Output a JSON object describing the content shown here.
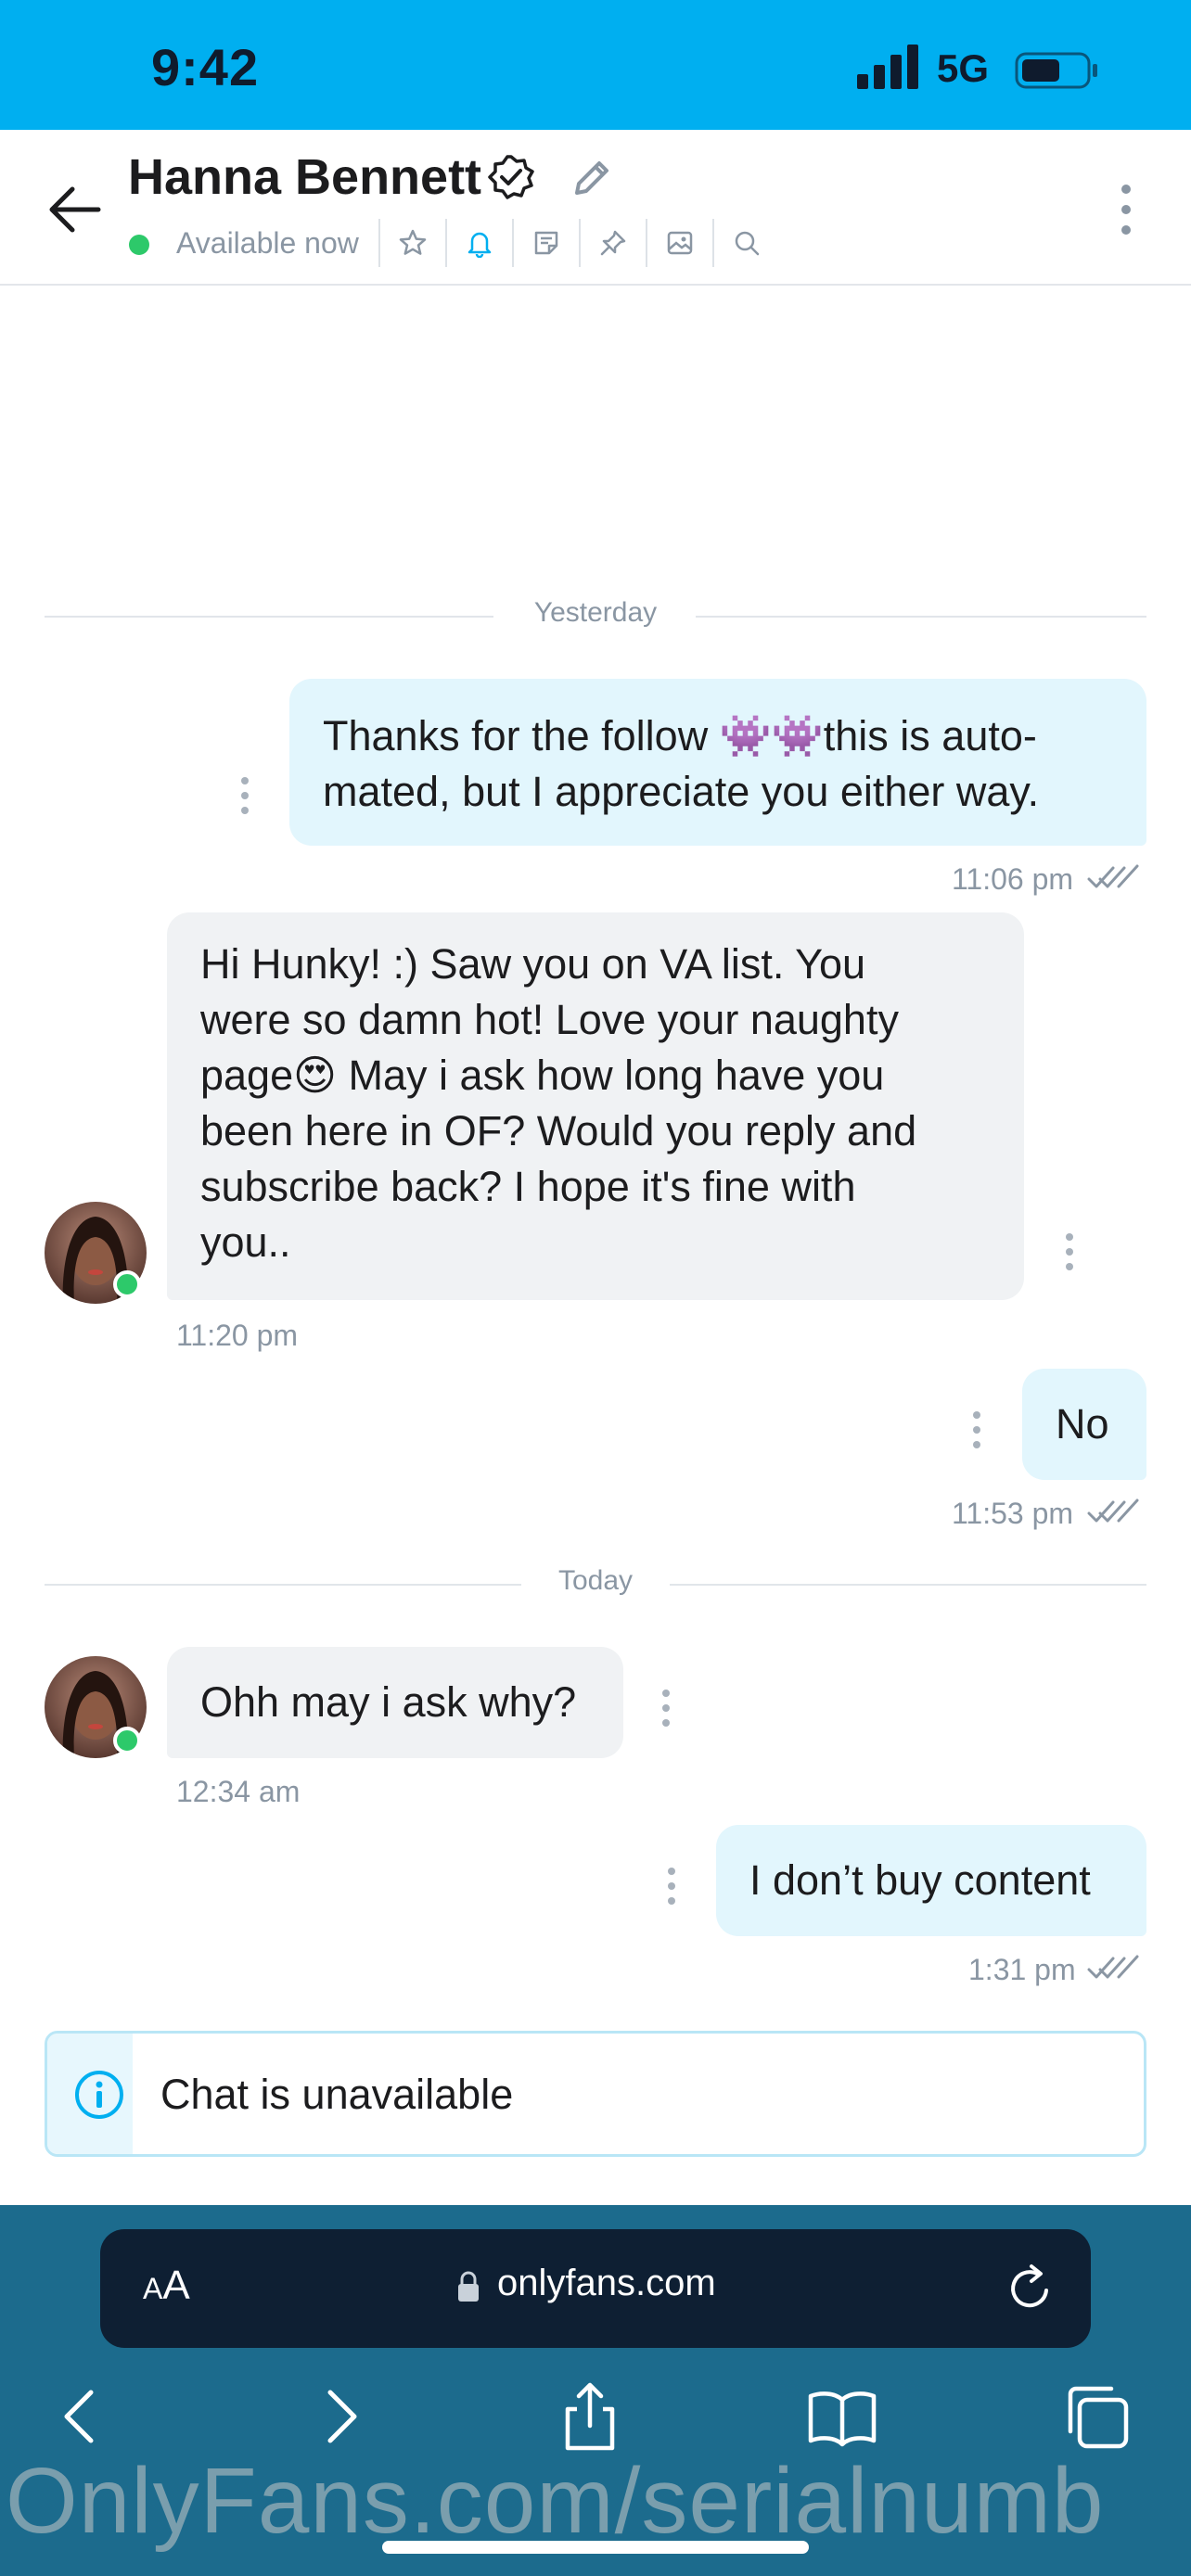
{
  "status_bar": {
    "time": "9:42",
    "network": "5G"
  },
  "header": {
    "name": "Hanna Bennett",
    "status": "Available now",
    "icons": [
      "star-icon",
      "bell-icon",
      "note-icon",
      "pin-icon",
      "image-icon",
      "search-icon"
    ]
  },
  "dividers": {
    "yesterday": "Yesterday",
    "today": "Today"
  },
  "messages": [
    {
      "direction": "out",
      "text_line1": "Thanks for the follow 👾👾this is auto-",
      "text_line2": "mated, but I appreciate you either way.",
      "time": "11:06 pm"
    },
    {
      "direction": "in",
      "lines": [
        "Hi Hunky! :) Saw you on VA list. You",
        "were so damn hot! Love your naughty",
        "page😍 May i ask how long have you",
        "been here in OF? Would you reply and",
        "subscribe back? I hope it's fine with",
        "you.."
      ],
      "time": "11:20 pm"
    },
    {
      "direction": "out",
      "text": "No",
      "time": "11:53 pm"
    },
    {
      "direction": "in",
      "text": "Ohh may i ask why?",
      "time": "12:34 am"
    },
    {
      "direction": "out",
      "text": "I don’t buy content",
      "time": "1:31 pm"
    }
  ],
  "notice": {
    "text": "Chat is unavailable"
  },
  "browser": {
    "aa_small": "A",
    "aa_large": "A",
    "url": "onlyfans.com"
  },
  "watermark": "OnlyFans.com/serialnumb",
  "colors": {
    "accent": "#00aff0",
    "online": "#2dc96a",
    "outgoing_bubble": "#e2f6fd",
    "incoming_bubble": "#f0f2f4",
    "toolbar": "#1c6b8d"
  }
}
